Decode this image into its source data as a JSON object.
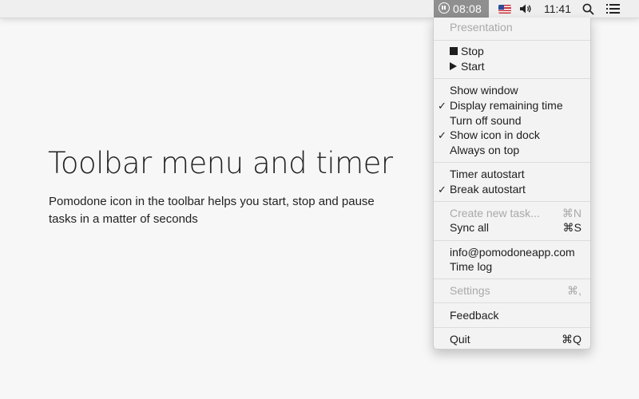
{
  "menubar": {
    "timer_time": "08:08",
    "clock_time": "11:41",
    "flag_colors": [
      "#c8303c",
      "#ffffff",
      "#2b4c9b"
    ],
    "timer_highlight_color": "#8f8f8f",
    "icons": [
      "pomodone-icon",
      "us-flag-icon",
      "volume-icon",
      "search-icon",
      "list-icon"
    ]
  },
  "content": {
    "headline": "Toolbar menu and timer",
    "description": "Pomodone icon in the toolbar helps you start, stop and pause tasks in a matter of seconds"
  },
  "menu": {
    "presentation": "Presentation",
    "stop": "Stop",
    "start": "Start",
    "show_window": "Show window",
    "display_remaining_time": "Display remaining time",
    "display_remaining_time_checked": true,
    "turn_off_sound": "Turn off sound",
    "show_icon_in_dock": "Show icon in dock",
    "show_icon_in_dock_checked": true,
    "always_on_top": "Always on top",
    "timer_autostart": "Timer autostart",
    "break_autostart": "Break autostart",
    "break_autostart_checked": true,
    "create_new_task": "Create new task...",
    "create_new_task_shortcut": "⌘N",
    "sync_all": "Sync all",
    "sync_all_shortcut": "⌘S",
    "email": "info@pomodoneapp.com",
    "time_log": "Time log",
    "settings": "Settings",
    "settings_shortcut": "⌘,",
    "feedback": "Feedback",
    "quit": "Quit",
    "quit_shortcut": "⌘Q",
    "check_mark": "✓"
  }
}
